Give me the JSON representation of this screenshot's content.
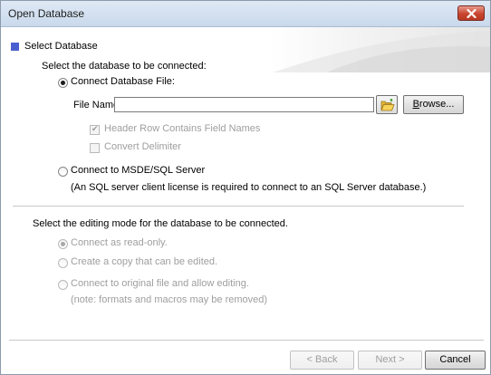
{
  "window": {
    "title": "Open Database"
  },
  "header": {
    "section_title": "Select Database"
  },
  "database": {
    "prompt": "Select the database to be connected:",
    "options": [
      {
        "label": "Connect Database File:",
        "selected": true
      },
      {
        "label": "Connect to MSDE/SQL Server",
        "selected": false
      }
    ],
    "file_name_label": "File Name:",
    "file_name_value": "",
    "browse_label": "Browse...",
    "header_row_label": "Header Row Contains Field Names",
    "header_row_checked": true,
    "convert_delimiter_label": "Convert Delimiter",
    "convert_delimiter_checked": false,
    "sql_note": "(An SQL server client license is required to connect to an SQL Server database.)"
  },
  "editing": {
    "prompt": "Select the editing mode for the database to be connected.",
    "options": [
      {
        "label": "Connect as read-only.",
        "selected": true
      },
      {
        "label": "Create a copy that can be edited.",
        "selected": false
      },
      {
        "label": "Connect to original file and allow editing.",
        "selected": false
      }
    ],
    "note": "(note:  formats and macros may be removed)"
  },
  "footer": {
    "back_label": "< Back",
    "next_label": "Next >",
    "cancel_label": "Cancel"
  },
  "icons": {
    "close": "close-icon",
    "folder": "folder-open-icon"
  },
  "colors": {
    "section_marker": "#4a5fcf",
    "close_button": "#c9452f"
  }
}
